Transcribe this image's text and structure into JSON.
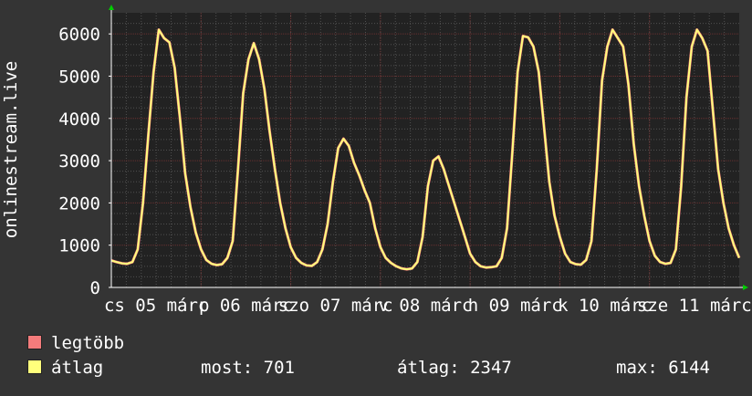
{
  "chart_data": {
    "type": "line",
    "ylabel": "onlinestream.live",
    "ylim": [
      0,
      6500
    ],
    "yticks": [
      0,
      1000,
      2000,
      3000,
      4000,
      5000,
      6000
    ],
    "x_tick_labels": [
      "cs 05 márc",
      "p 06 márc",
      "szo 07 márc",
      "v 08 márc",
      "h 09 márc",
      "k 10 márc",
      "sze 11 márc"
    ],
    "grid": true,
    "series": [
      {
        "name": "legtöbb",
        "color": "#f47c7c",
        "values": [
          640,
          600,
          570,
          560,
          600,
          900,
          2000,
          3600,
          5100,
          6100,
          5900,
          5800,
          5200,
          4000,
          2700,
          1900,
          1300,
          900,
          650,
          560,
          530,
          550,
          700,
          1100,
          2800,
          4600,
          5400,
          5780,
          5400,
          4700,
          3700,
          2800,
          2000,
          1400,
          950,
          700,
          580,
          520,
          510,
          600,
          900,
          1500,
          2500,
          3300,
          3520,
          3350,
          2950,
          2650,
          2300,
          2000,
          1400,
          950,
          700,
          580,
          500,
          450,
          430,
          450,
          600,
          1200,
          2400,
          3000,
          3100,
          2800,
          2400,
          2000,
          1600,
          1200,
          800,
          600,
          500,
          470,
          480,
          500,
          700,
          1400,
          3200,
          5100,
          5950,
          5920,
          5700,
          5100,
          3800,
          2500,
          1700,
          1200,
          800,
          600,
          550,
          540,
          650,
          1100,
          2800,
          4900,
          5700,
          6100,
          5900,
          5700,
          4800,
          3400,
          2400,
          1700,
          1100,
          750,
          600,
          560,
          580,
          900,
          2400,
          4500,
          5700,
          6100,
          5900,
          5600,
          4200,
          2800,
          2000,
          1400,
          1000,
          700
        ]
      },
      {
        "name": "átlag",
        "color": "#ffff7c",
        "values": [
          640,
          600,
          570,
          560,
          600,
          900,
          2000,
          3600,
          5100,
          6100,
          5900,
          5800,
          5200,
          4000,
          2700,
          1900,
          1300,
          900,
          650,
          560,
          530,
          550,
          700,
          1100,
          2800,
          4600,
          5400,
          5780,
          5400,
          4700,
          3700,
          2800,
          2000,
          1400,
          950,
          700,
          580,
          520,
          510,
          600,
          900,
          1500,
          2500,
          3300,
          3520,
          3350,
          2950,
          2650,
          2300,
          2000,
          1400,
          950,
          700,
          580,
          500,
          450,
          430,
          450,
          600,
          1200,
          2400,
          3000,
          3100,
          2800,
          2400,
          2000,
          1600,
          1200,
          800,
          600,
          500,
          470,
          480,
          500,
          700,
          1400,
          3200,
          5100,
          5950,
          5920,
          5700,
          5100,
          3800,
          2500,
          1700,
          1200,
          800,
          600,
          550,
          540,
          650,
          1100,
          2800,
          4900,
          5700,
          6100,
          5900,
          5700,
          4800,
          3400,
          2400,
          1700,
          1100,
          750,
          600,
          560,
          580,
          900,
          2400,
          4500,
          5700,
          6100,
          5900,
          5600,
          4200,
          2800,
          2000,
          1400,
          1000,
          700
        ]
      }
    ]
  },
  "stats": {
    "now_label": "most:",
    "now_value": "701",
    "avg_label": "átlag:",
    "avg_value": "2347",
    "max_label": "max:",
    "max_value": "6144"
  },
  "colors": {
    "background": "#343434",
    "plot_background": "#222222",
    "grid": "#505050",
    "grid_major": "#6a3030",
    "axis": "#ffffff",
    "arrow": "#00cc00"
  }
}
